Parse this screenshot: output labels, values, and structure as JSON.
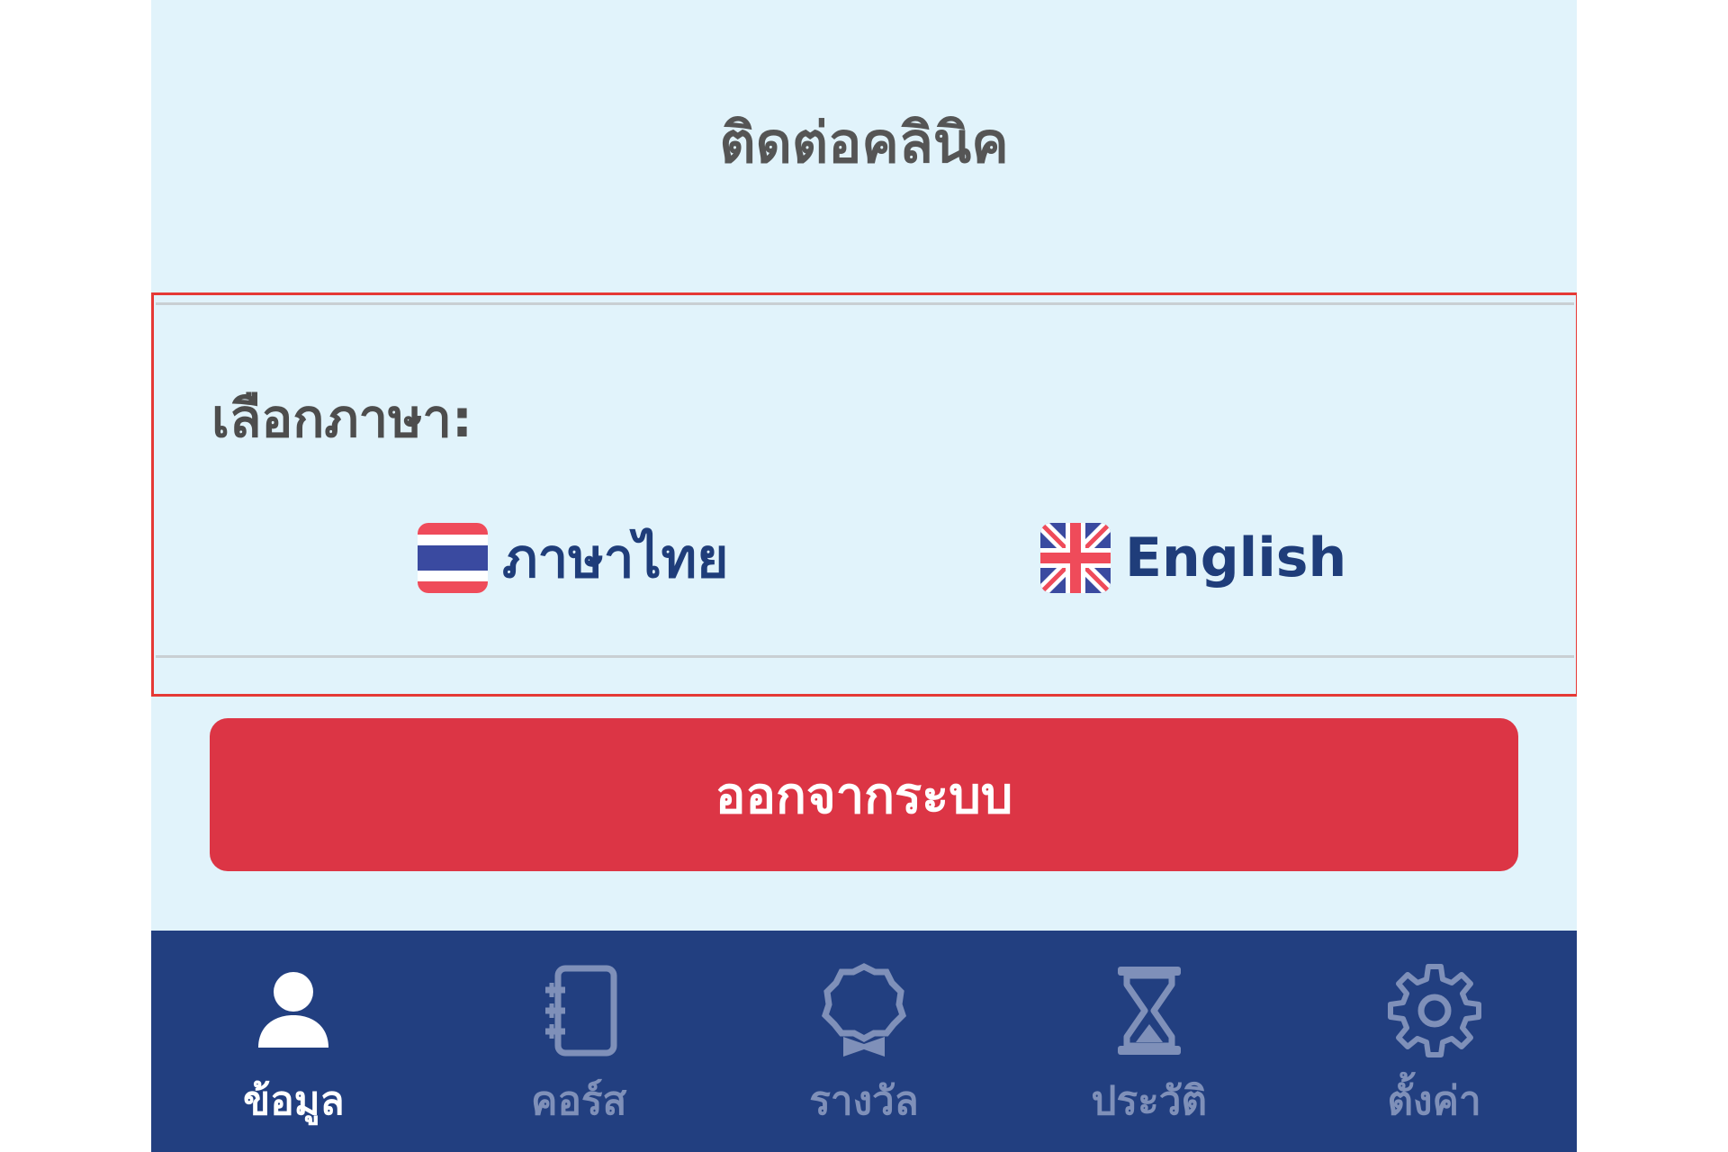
{
  "contact_clinic_label": "ติดต่อคลินิค",
  "language_section": {
    "label": "เลือกภาษา:",
    "options": [
      {
        "label": "ภาษาไทย",
        "flag": "thai-flag-icon"
      },
      {
        "label": "English",
        "flag": "uk-flag-icon"
      }
    ]
  },
  "logout_label": "ออกจากระบบ",
  "tabs": [
    {
      "label": "ข้อมูล",
      "icon": "person-icon",
      "active": true
    },
    {
      "label": "คอร์ส",
      "icon": "notebook-icon",
      "active": false
    },
    {
      "label": "รางวัล",
      "icon": "award-icon",
      "active": false
    },
    {
      "label": "ประวัติ",
      "icon": "hourglass-icon",
      "active": false
    },
    {
      "label": "ตั้งค่า",
      "icon": "gear-icon",
      "active": false
    }
  ],
  "colors": {
    "background": "#e1f3fb",
    "tabbar": "#223f80",
    "logout": "#dc3545",
    "highlight_border": "#e53935",
    "tab_inactive": "#7f90b9",
    "tab_active": "#ffffff"
  }
}
